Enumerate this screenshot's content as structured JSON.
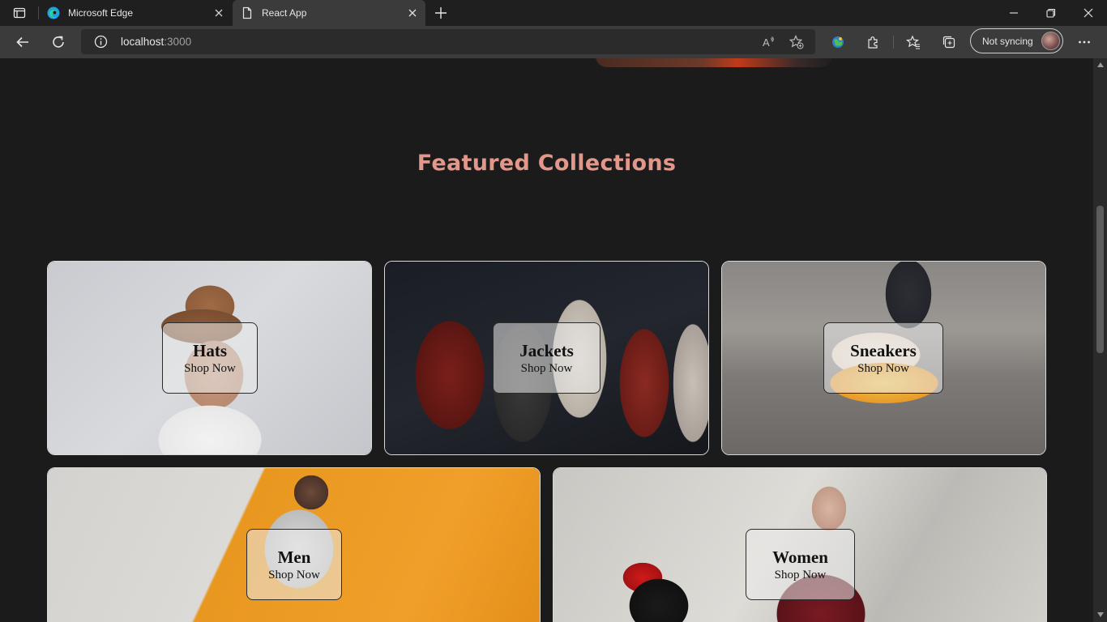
{
  "browser": {
    "tabs": [
      {
        "title": "Microsoft Edge",
        "icon": "edge-logo-icon"
      },
      {
        "title": "React App",
        "icon": "page-icon"
      }
    ],
    "address": {
      "host": "localhost",
      "port": ":3000"
    },
    "sync_label": "Not syncing",
    "colors": {
      "titlebar": "#1f1f1f",
      "toolbar": "#3b3b3b",
      "omnibox": "#2b2b2b"
    }
  },
  "page": {
    "heading": "Featured Collections",
    "heading_color": "#e3978a",
    "background": "#1b1b1b",
    "collections": [
      {
        "name": "Hats",
        "cta": "Shop Now",
        "image": "man-in-brown-hat-photo"
      },
      {
        "name": "Jackets",
        "cta": "Shop Now",
        "image": "leather-jackets-photo"
      },
      {
        "name": "Sneakers",
        "cta": "Shop Now",
        "image": "sneakers-on-curb-photo"
      },
      {
        "name": "Men",
        "cta": "Shop Now",
        "image": "man-in-hoodie-orange-wall-photo"
      },
      {
        "name": "Women",
        "cta": "Shop Now",
        "image": "woman-with-shopping-bags-photo"
      }
    ]
  }
}
